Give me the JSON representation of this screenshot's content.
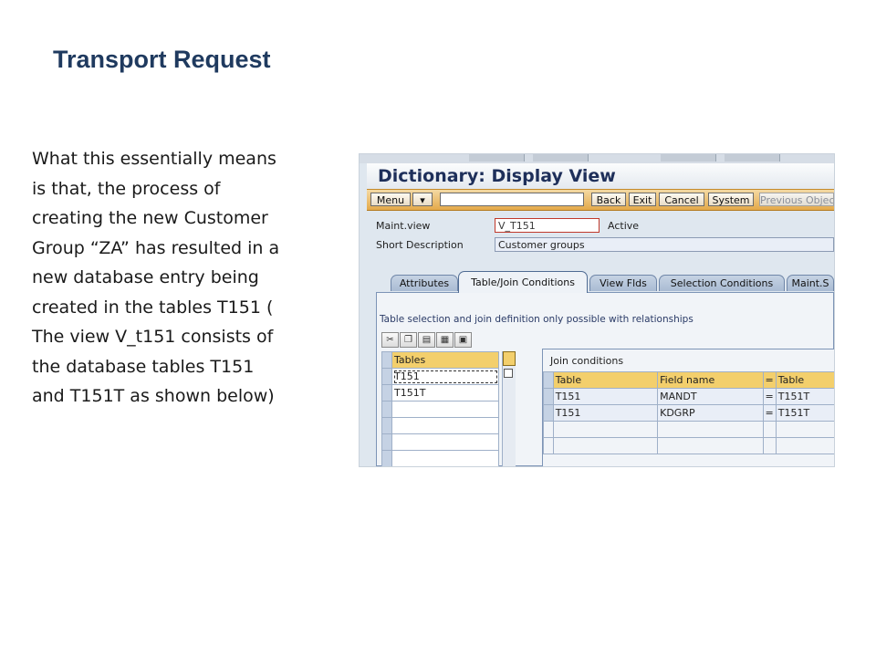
{
  "slide": {
    "title": "Transport Request",
    "paragraph_lines": [
      "What this essentially means",
      "is that, the process of",
      "creating the new Customer",
      "Group “ZA” has resulted in a",
      "new database entry being",
      "created in the tables T151 (",
      "The view V_t151 consists of",
      "the database tables T151",
      "and T151T  as shown below)"
    ]
  },
  "sap": {
    "title": "Dictionary: Display View",
    "menu": {
      "menu_label": "Menu",
      "back_label": "Back",
      "exit_label": "Exit",
      "cancel_label": "Cancel",
      "system_label": "System",
      "previous_objects_label": "Previous Objec"
    },
    "fields": {
      "maint_view_label": "Maint.view",
      "maint_view_value": "V_T151",
      "maint_view_status": "Active",
      "short_desc_label": "Short Description",
      "short_desc_value": "Customer groups"
    },
    "tabs": [
      {
        "label": "Attributes",
        "active": false
      },
      {
        "label": "Table/Join Conditions",
        "active": true
      },
      {
        "label": "View Flds",
        "active": false
      },
      {
        "label": "Selection Conditions",
        "active": false
      },
      {
        "label": "Maint.S",
        "active": false
      }
    ],
    "hint": "Table selection and join definition only possible with relationships",
    "tables_grid": {
      "header": "Tables",
      "rows": [
        "T151",
        "T151T",
        "",
        "",
        "",
        ""
      ]
    },
    "join_conditions": {
      "title": "Join conditions",
      "headers": [
        "Table",
        "Field name",
        "=",
        "Table"
      ],
      "rows": [
        [
          "T151",
          "MANDT",
          "=",
          "T151T"
        ],
        [
          "T151",
          "KDGRP",
          "=",
          "T151T"
        ]
      ]
    }
  }
}
